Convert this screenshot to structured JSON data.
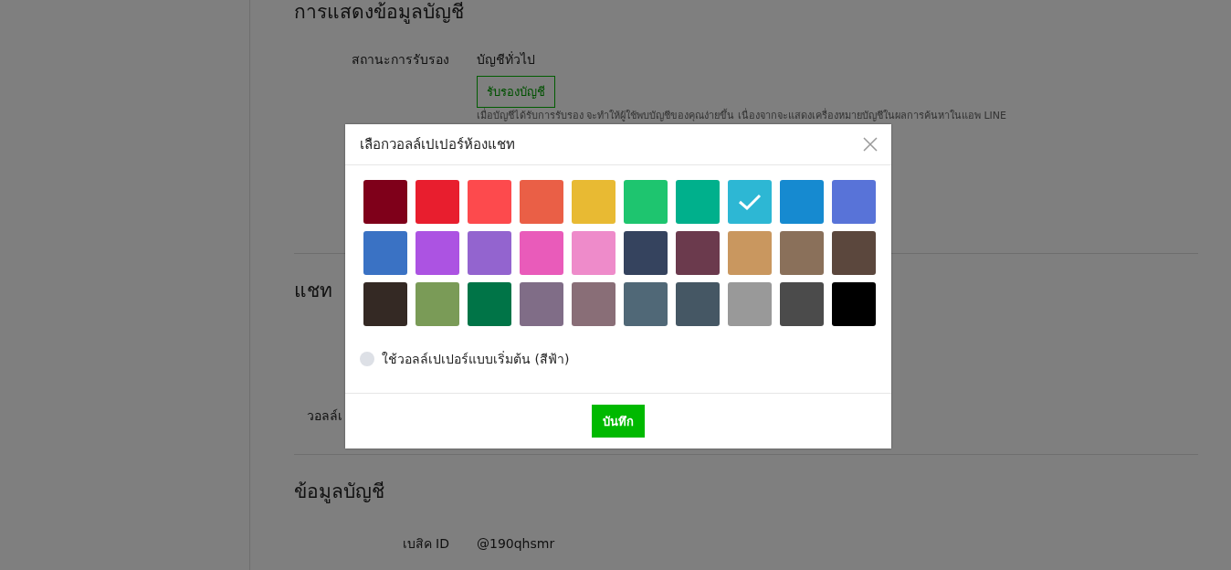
{
  "page": {
    "sections": [
      {
        "title": "การแสดงข้อมูลบัญชี",
        "rows": [
          {
            "label": "สถานะการรับรอง",
            "value": "บัญชีทั่วไป",
            "button": "รับรองบัญชี",
            "hint": "เมื่อบัญชีได้รับการรับรอง จะทำให้ผู้ใช้พบบัญชีของคุณง่ายขึ้น เนื่องจากจะแสดงเครื่องหมายบัญชีในผลการค้นหาในแอพ LINE"
          }
        ]
      },
      {
        "title": "แชท",
        "rows": [
          {
            "label": "วอลล์เ"
          }
        ]
      },
      {
        "title": "ข้อมูลบัญชี",
        "rows": [
          {
            "label": "เบสิค ID",
            "value": "@190qhsmr"
          }
        ]
      }
    ]
  },
  "dialog": {
    "title": "เลือกวอลล์เปเปอร์ห้องแชท",
    "swatches": [
      {
        "color": "#7f001a",
        "selected": false
      },
      {
        "color": "#e81e2e",
        "selected": false
      },
      {
        "color": "#fd4a4d",
        "selected": false
      },
      {
        "color": "#ea5f46",
        "selected": false
      },
      {
        "color": "#e8ba33",
        "selected": false
      },
      {
        "color": "#1ec56f",
        "selected": false
      },
      {
        "color": "#00b08c",
        "selected": false
      },
      {
        "color": "#2db7d4",
        "selected": true
      },
      {
        "color": "#168ad0",
        "selected": false
      },
      {
        "color": "#5873d8",
        "selected": false
      },
      {
        "color": "#3a72c4",
        "selected": false
      },
      {
        "color": "#ac53e2",
        "selected": false
      },
      {
        "color": "#9364cf",
        "selected": false
      },
      {
        "color": "#e95bba",
        "selected": false
      },
      {
        "color": "#ee8bca",
        "selected": false
      },
      {
        "color": "#35435e",
        "selected": false
      },
      {
        "color": "#6b3a4d",
        "selected": false
      },
      {
        "color": "#c9975f",
        "selected": false
      },
      {
        "color": "#8a705a",
        "selected": false
      },
      {
        "color": "#5b473d",
        "selected": false
      },
      {
        "color": "#342924",
        "selected": false
      },
      {
        "color": "#7a9b57",
        "selected": false
      },
      {
        "color": "#007447",
        "selected": false
      },
      {
        "color": "#806d87",
        "selected": false
      },
      {
        "color": "#896e77",
        "selected": false
      },
      {
        "color": "#506877",
        "selected": false
      },
      {
        "color": "#455764",
        "selected": false
      },
      {
        "color": "#999999",
        "selected": false
      },
      {
        "color": "#4b4b4b",
        "selected": false
      },
      {
        "color": "#000000",
        "selected": false
      }
    ],
    "default_option": {
      "label": "ใช้วอลล์เปเปอร์แบบเริ่มต้น (สีฟ้า)",
      "selected": false
    },
    "save_button": "บันทึก"
  }
}
